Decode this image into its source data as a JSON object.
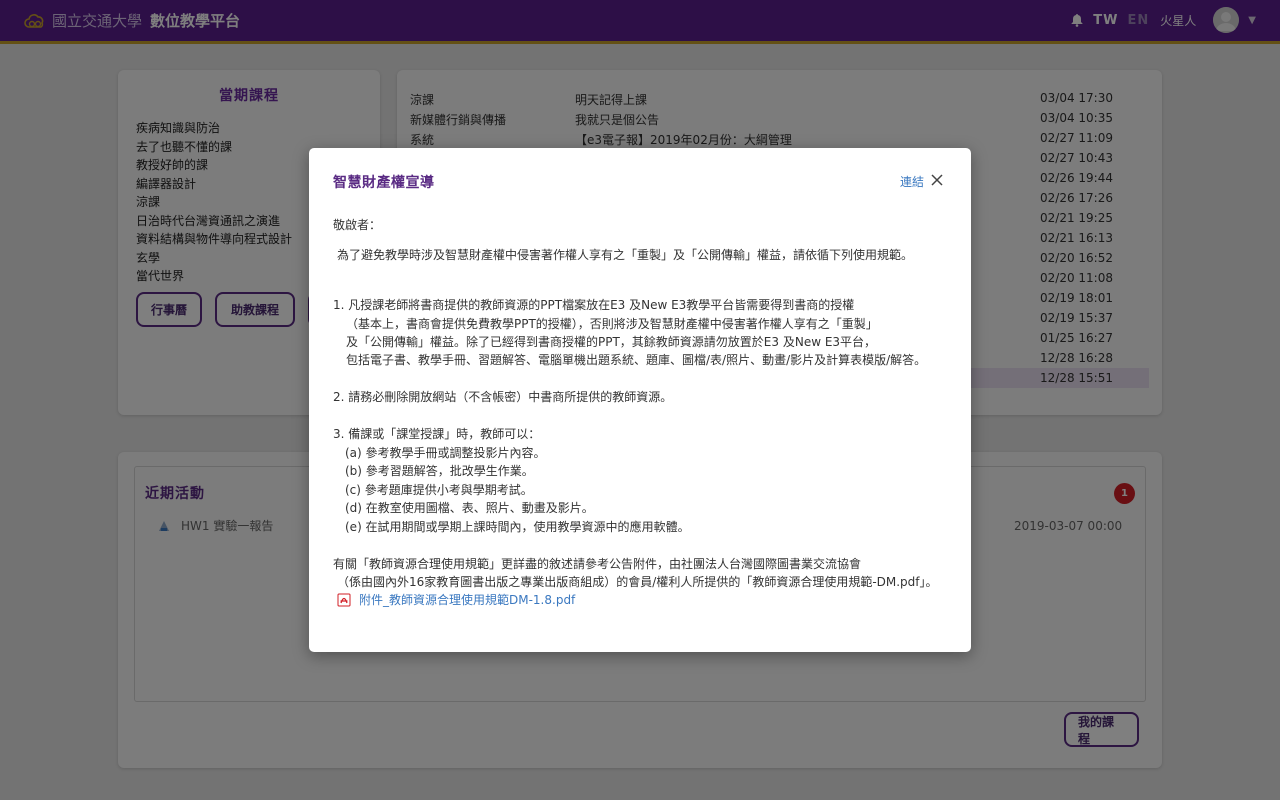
{
  "header": {
    "school": "國立交通大學",
    "platform": "數位教學平台",
    "lang_tw": "TW",
    "lang_en": "EN",
    "username": "火星人",
    "icons": [
      "cloud-logo-icon",
      "bell-icon",
      "avatar",
      "caret-down-icon"
    ]
  },
  "courses": {
    "title": "當期課程",
    "items": [
      "疾病知識與防治",
      "去了也聽不懂的課",
      "教授好帥的課",
      "編譯器設計",
      "涼課",
      "日治時代台灣資通訊之演進",
      "資料結構與物件導向程式設計",
      "玄學",
      "當代世界"
    ],
    "buttons": {
      "calendar": "行事曆",
      "ta_courses": "助教課程"
    }
  },
  "news": {
    "rows": [
      {
        "cat": "涼課",
        "title": "明天記得上課",
        "time": "03/04 17:30"
      },
      {
        "cat": "新媒體行銷與傳播",
        "title": "我就只是個公告",
        "time": "03/04 10:35"
      },
      {
        "cat": "系統",
        "title": "【e3電子報】2019年02月份：大綱管理",
        "time": "02/27 11:09"
      },
      {
        "cat": "",
        "title": "",
        "time": "02/27 10:43"
      },
      {
        "cat": "",
        "title": "",
        "time": "02/26 19:44"
      },
      {
        "cat": "",
        "title": "",
        "time": "02/26 17:26"
      },
      {
        "cat": "",
        "title": "",
        "time": "02/21 19:25"
      },
      {
        "cat": "",
        "title": "",
        "time": "02/21 16:13"
      },
      {
        "cat": "",
        "title": "",
        "time": "02/20 16:52"
      },
      {
        "cat": "",
        "title": "",
        "time": "02/20 11:08"
      },
      {
        "cat": "",
        "title": "",
        "time": "02/19 18:01"
      },
      {
        "cat": "",
        "title": "",
        "time": "02/19 15:37"
      },
      {
        "cat": "",
        "title": "",
        "time": "01/25 16:27"
      },
      {
        "cat": "",
        "title": "",
        "time": "12/28 16:28"
      },
      {
        "cat": "",
        "title": "",
        "time": "12/28 15:51"
      }
    ]
  },
  "activity": {
    "title": "近期活動",
    "badge": "1",
    "item_title": "HW1 實驗一報告",
    "item_time": "2019-03-07 00:00",
    "my_courses": "我的課程"
  },
  "modal": {
    "title": "智慧財產權宣導",
    "link": "連結",
    "greeting": "敬啟者：",
    "intro": "為了避免教學時涉及智慧財產權中侵害著作權人享有之「重製」及「公開傳輸」權益，請依循下列使用規範。",
    "p1": [
      "1. 凡授課老師將書商提供的教師資源的PPT檔案放在E3 及New E3教學平台皆需要得到書商的授權",
      "（基本上，書商會提供免費教學PPT的授權），否則將涉及智慧財產權中侵害著作權人享有之「重製」",
      "及「公開傳輸」權益。除了已經得到書商授權的PPT，其餘教師資源請勿放置於E3 及New E3平台，",
      "包括電子書、教學手冊、習題解答、電腦單機出題系統、題庫、圖檔/表/照片、動畫/影片及計算表模版/解答。"
    ],
    "p2": "2. 請務必刪除開放網站（不含帳密）中書商所提供的教師資源。",
    "p3": [
      "3. 備課或「課堂授課」時，教師可以：",
      "(a) 參考教學手冊或調整投影片內容。",
      "(b) 參考習題解答，批改學生作業。",
      "(c) 參考題庫提供小考與學期考試。",
      "(d) 在教室使用圖檔、表、照片、動畫及影片。",
      "(e) 在試用期間或學期上課時間內，使用教學資源中的應用軟體。"
    ],
    "footer": [
      "有關「教師資源合理使用規範」更詳盡的敘述請參考公告附件，由社團法人台灣國際圖書業交流協會",
      "（係由國內外16家教育圖書出版之專業出版商組成）的會員/權利人所提供的「教師資源合理使用規範-DM.pdf」。"
    ],
    "attachment": "附件_教師資源合理使用規範DM-1.8.pdf"
  },
  "colors": {
    "topbar": "#5a1f8e",
    "topbar_border": "#c9a12b",
    "accent": "#5a2b84",
    "link": "#3a78c0",
    "badge": "#d21f26"
  }
}
